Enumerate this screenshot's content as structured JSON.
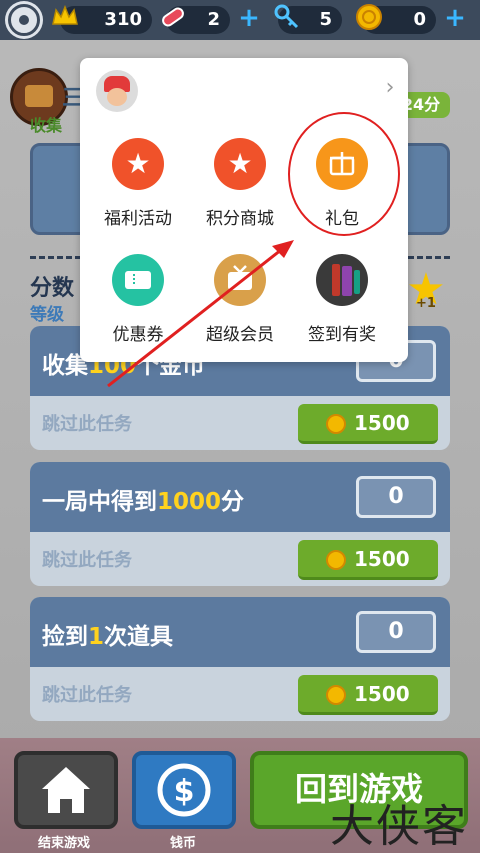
{
  "topbar": {
    "crowns": "310",
    "boards": "2",
    "keys": "5",
    "coins": "0"
  },
  "behind": {
    "title": "三",
    "subtitle": "收集",
    "score_pill": "24分",
    "score_heading": "分数",
    "level_label": "等级",
    "star_bonus": "+1"
  },
  "popup": {
    "items": [
      {
        "label": "福利活动",
        "icon": "star-badge-icon"
      },
      {
        "label": "积分商城",
        "icon": "star-badge-icon"
      },
      {
        "label": "礼包",
        "icon": "gift-icon"
      },
      {
        "label": "优惠券",
        "icon": "ticket-icon"
      },
      {
        "label": "超级会员",
        "icon": "tv-icon"
      },
      {
        "label": "签到有奖",
        "icon": "phone-icon"
      }
    ]
  },
  "missions": [
    {
      "title_pre": "收集",
      "title_num": "100",
      "title_post": "个金币",
      "count": "0",
      "skip": "跳过此任务",
      "cost": "1500"
    },
    {
      "title_pre": "一局中得到",
      "title_num": "1000",
      "title_post": "分",
      "count": "0",
      "skip": "跳过此任务",
      "cost": "1500"
    },
    {
      "title_pre": "捡到",
      "title_num": "1",
      "title_post": "次道具",
      "count": "0",
      "skip": "跳过此任务",
      "cost": "1500"
    }
  ],
  "bottom": {
    "end_game_label": "结束游戏",
    "coins_label": "钱币",
    "back_to_game": "回到游戏"
  },
  "watermark": "大侠客",
  "colors": {
    "accent_red": "#e02020",
    "button_green": "#6dab2b",
    "highlight_yellow": "#ffd21e"
  }
}
